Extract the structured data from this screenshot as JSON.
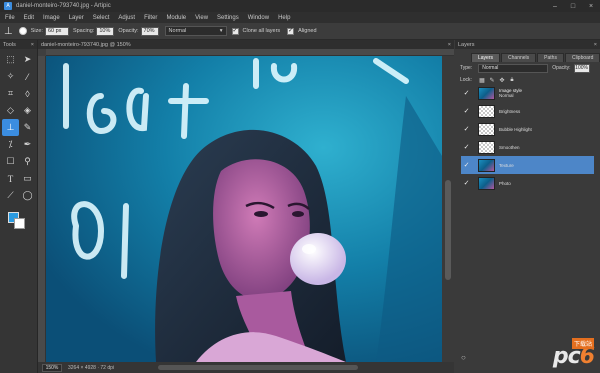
{
  "window": {
    "title": "daniel-monteiro-793740.jpg - Artipic",
    "app_icon": "A"
  },
  "menu": [
    "File",
    "Edit",
    "Image",
    "Layer",
    "Select",
    "Adjust",
    "Filter",
    "Module",
    "View",
    "Settings",
    "Window",
    "Help"
  ],
  "options": {
    "size_label": "Size:",
    "size_value": "60 px",
    "spacing_label": "Spacing:",
    "spacing_value": "10%",
    "opacity_label": "Opacity:",
    "opacity_value": "70%",
    "mode_value": "Normal",
    "clone_all_label": "Clone all layers",
    "aligned_label": "Aligned"
  },
  "tools_panel": {
    "title": "Tools",
    "close": "×"
  },
  "document": {
    "tab_title": "daniel-monteiro-793740.jpg @ 150%",
    "close": "×",
    "zoom": "150%",
    "info": "3264 × 4928 · 72 dpi"
  },
  "layers_panel": {
    "title": "Layers",
    "close": "×",
    "tabs": [
      "Layers",
      "Channels",
      "Paths",
      "Clipboard"
    ],
    "type_label": "Type:",
    "type_value": "Normal",
    "opacity_label": "Opacity:",
    "opacity_value": "100%",
    "lock_label": "Lock:",
    "layers": [
      {
        "name": "Image style",
        "sub": "Normal",
        "thumb": "photo"
      },
      {
        "name": "Brightness",
        "sub": "",
        "thumb": "checker"
      },
      {
        "name": "Bubble Highlight",
        "sub": "",
        "thumb": "checker"
      },
      {
        "name": "Smoothen",
        "sub": "",
        "thumb": "checker"
      },
      {
        "name": "Texture",
        "sub": "",
        "thumb": "photo",
        "selected": true
      },
      {
        "name": "Photo",
        "sub": "",
        "thumb": "photo"
      }
    ]
  },
  "watermark": {
    "text_main": "pc",
    "text_six": "6",
    "badge": "下载站"
  },
  "colors": {
    "accent": "#3b8de0",
    "selection": "#4d86c8",
    "foreground": "#2a9ae0",
    "background": "#ffffff"
  }
}
